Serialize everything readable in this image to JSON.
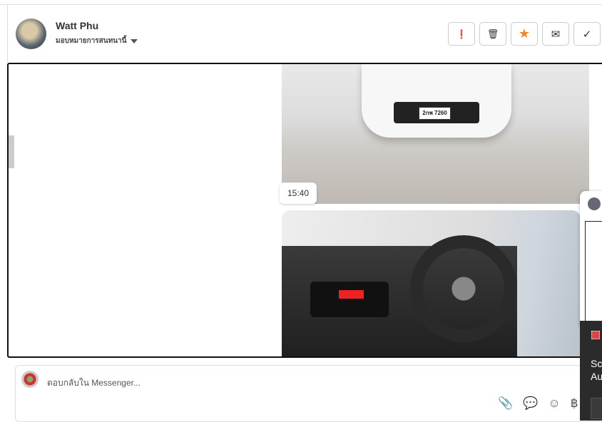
{
  "header": {
    "name": "Watt Phu",
    "assign_label": "มอบหมายการสนทนานี้"
  },
  "actions": [
    {
      "icon": "alert-icon",
      "glyph": "❗"
    },
    {
      "icon": "trash-icon",
      "glyph": "🗑"
    },
    {
      "icon": "star-icon",
      "glyph": "★",
      "color": "#f5842a"
    },
    {
      "icon": "mail-icon",
      "glyph": "✉"
    },
    {
      "icon": "check-icon",
      "glyph": "✓"
    }
  ],
  "messages": {
    "plate": "2กพ 7260",
    "timestamp": "15:40"
  },
  "composer": {
    "placeholder": "ตอบกลับใน Messenger...",
    "tools": [
      "📎",
      "💬",
      "☺",
      "฿"
    ]
  },
  "toast": {
    "line1": "Sc",
    "line2": "Au"
  }
}
